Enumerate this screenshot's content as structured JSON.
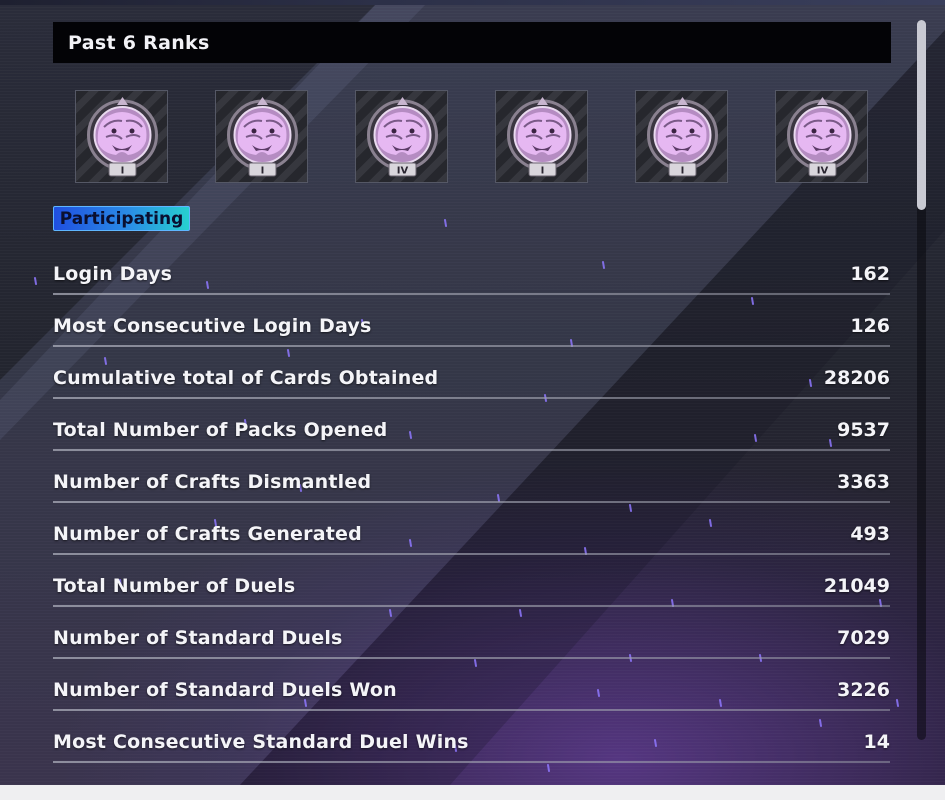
{
  "header": {
    "title": "Past 6 Ranks"
  },
  "ranks": [
    {
      "icon": "tiger-rank-emblem-icon",
      "tier": "I"
    },
    {
      "icon": "tiger-rank-emblem-icon",
      "tier": "I"
    },
    {
      "icon": "tiger-rank-emblem-icon",
      "tier": "IV"
    },
    {
      "icon": "tiger-rank-emblem-icon",
      "tier": "I"
    },
    {
      "icon": "tiger-rank-emblem-icon",
      "tier": "I"
    },
    {
      "icon": "tiger-rank-emblem-icon",
      "tier": "IV"
    }
  ],
  "status_badge": {
    "label": "Participating"
  },
  "stats": [
    {
      "label": "Login Days",
      "value": "162"
    },
    {
      "label": "Most Consecutive Login Days",
      "value": "126"
    },
    {
      "label": "Cumulative total of Cards Obtained",
      "value": "28206"
    },
    {
      "label": "Total Number of Packs Opened",
      "value": "9537"
    },
    {
      "label": "Number of Crafts Dismantled",
      "value": "3363"
    },
    {
      "label": "Number of Crafts Generated",
      "value": "493"
    },
    {
      "label": "Total Number of Duels",
      "value": "21049"
    },
    {
      "label": "Number of Standard Duels",
      "value": "7029"
    },
    {
      "label": "Number of Standard Duels Won",
      "value": "3226"
    },
    {
      "label": "Most Consecutive Standard Duel Wins",
      "value": "14"
    }
  ],
  "colors": {
    "title_bar_bg": "#030306",
    "badge_gradient_start": "#1f4fe0",
    "badge_gradient_end": "#27d0cf",
    "rank_emblem": "#e6b8f2",
    "text": "#f4f4f8"
  }
}
